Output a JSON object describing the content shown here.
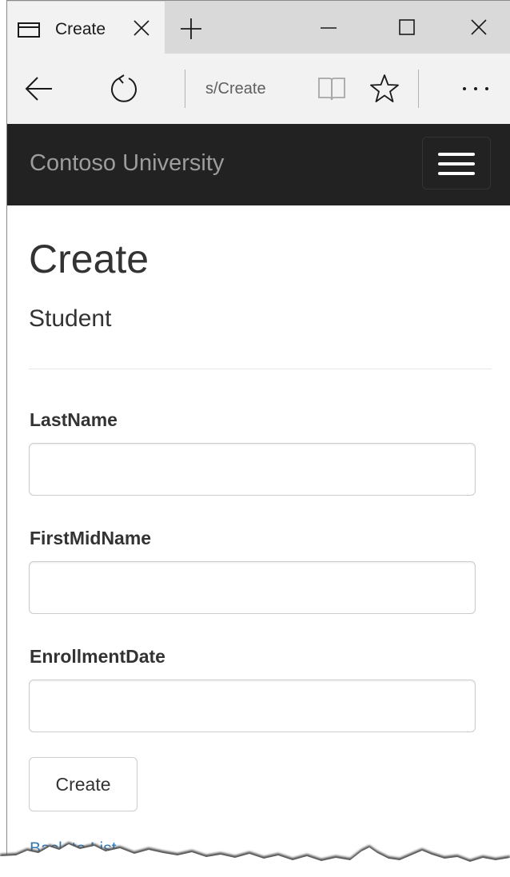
{
  "browser": {
    "tab_title": "Create",
    "address_text": "s/Create",
    "icons": {
      "page": "page-icon",
      "close_tab": "close-icon",
      "new_tab": "plus-icon",
      "minimize": "minimize-icon",
      "maximize": "maximize-icon",
      "close_window": "close-icon",
      "back": "back-arrow-icon",
      "refresh": "refresh-icon",
      "reading_view": "book-icon",
      "favorite": "star-icon",
      "more": "more-icon"
    }
  },
  "navbar": {
    "brand": "Contoso University",
    "menu_icon": "hamburger-icon"
  },
  "page": {
    "title": "Create",
    "subtitle": "Student",
    "fields": [
      {
        "label": "LastName",
        "value": ""
      },
      {
        "label": "FirstMidName",
        "value": ""
      },
      {
        "label": "EnrollmentDate",
        "value": ""
      }
    ],
    "submit_label": "Create",
    "back_link": "Back to List"
  },
  "colors": {
    "navbar_bg": "#222222",
    "brand_text": "#9d9d9d",
    "link": "#337ab7"
  }
}
